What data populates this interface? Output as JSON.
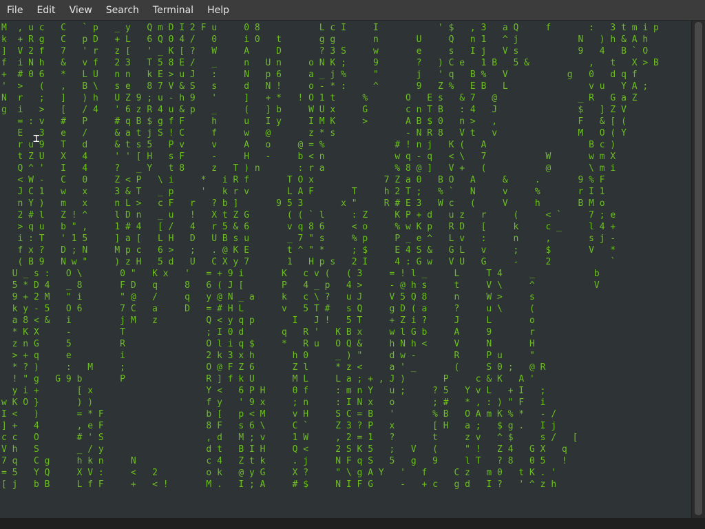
{
  "menubar": {
    "items": [
      {
        "label": "File"
      },
      {
        "label": "Edit"
      },
      {
        "label": "View"
      },
      {
        "label": "Search"
      },
      {
        "label": "Terminal"
      },
      {
        "label": "Help"
      }
    ]
  },
  "terminal": {
    "text_color": "#6cbf1e",
    "highlight_color": "#ffffff",
    "background": "#2e3436",
    "rows": [
      "M  , u c   C   ` p   _ y   Q m D I 2 F u     0 8           L c I     I           ' $   , 3   a Q     f       :   3 t m i p",
      "k  + R g   C   p D   + L   6 Q 0 4 /   0     i 0   t       g g       n       U     Q   n 1   ^ j           N   ) h & A h",
      "]  V 2 f   7   ' r   z [   ' _ K [ ?   W     A     D       ? 3 S     w       e     s   I j   V s           9   4   B ` O",
      "f  i N h   &   v f   2 3   T 5 8 E /   _     n   U n     o N K ;     9       ?   ) C e   1 B   5 &           ,   t   X > B",
      "+  # 0 6   *   L U   n n   k E > u J   :     N   p 6     a _ j %     \"       j   ' q   B %   V           g   0   d q f",
      "'  >   (   ,   B \\   s e   8 7 V & S   s     d   N !     o - * :     ^       9   Z %   E B   L               v u   Y A ;",
      "N  r   ;   ]   ) h   U Z 9 ; u - h 9   '     ]   + *   ! O 1 t     %       O   E s   & 7   @               _ R   G a Z",
      "g  i   >   [   / 4   ' 6 z R 4 u & p   _     (   ] b     W U x     G       c n T B   : 4   J               $   ] Z V",
      "   = : v   #   P     # q B $ g f F     h     u   I y     I M K     >       A B $ 0   n >   ,               F   & [ (",
      "   E   3   e   /     & a t j S ! C     f     w   @       z * s             - N R 8   V t   v               M   O ( Y",
      "   r u 9   T   d     & t s 5   P v     v     A   o     @ = %             # ! n j   K (   A                   B c )",
      "   t Z U   X   4     ' ' [ H   s F     -     H   -     b < n             w q - q   < \\   7           W       w m X",
      "   Q ^ '   I   4     ?   _ Y   t 8     z   T ) n       : r a             % 8 @ ]   V +   (           @       \\ m i",
      "   < W -   C   0     Z < P   \\ i     *   i R f       T O x             7 Z a 0   B O   A     &     .       9 % F",
      "   J C 1   w   x     3 & T   _ p     '   k r v       L A F       T     h 2 T ;   % `   N     v     %       r I 1",
      "   n Y )   m   x     n L >   c F   r   ? b ]       9 5 3       x \"     R # E 3   W c   (     V     h       B M o",
      "   2 # l   Z ! ^     l D n   _ u   !   X t Z G       ( ( ` l     : Z     K P + d   u z   r     (     < `     7 ; e",
      "   > q u   b \" ,     1 # 4   [ /   4   r 5 & 6       v q 8 6     < o     % w K p   R D   [     k     c _     l 4 +",
      "   i : T   ' 1 5     ] a [   L H   D   U B s u       _ 7 \" s     % p     P _ e ^   L v   :     n     ,       s j -",
      "   f x ?   D ; N     M p c   6 >   ;   . @ K E       t ^ \" *     ; $     E 4 S &   G L   v     ;     $       V   *",
      "   ( B 9   N w \"     ) z H   5 d   U   C X y 7       1   H p s   2 I     4 : G w   V U   G     -     2           `",
      "  U _ s :   O \\       0 \"   K x   '   = + 9 i       K   c v (   ( 3     = ! l _     L     T 4     _           b",
      "  5 * D 4   _ 8       F D   q     8   6 ( J [       P   4 _ p   4 >     - @ h s     t     V \\     ^           V",
      "  9 + 2 M   \" i       \" @   /     q   y @ N _ a     k   c \\ ?   u J     V 5 Q 8     n     W >     s",
      "  k y - 5   O 6       7 C   a     D   = # H L       v   5 T #   s Q     g D ( a     ?     u \\     (",
      "  a 8 < &   i         j M   z         Q < y q p       I   J !   5 T     + Z i ?     J     L       o",
      "  * K X     -         T               ; I 0 d       q   R '   K B x     w l G b     A     9       r",
      "  z n G     5         R               O l i q $     *   R u   O Q &     h N h <     V     N       H",
      "  > + q     e         i               2 k 3 x h       h 0     _ ) \"     d w -       R     P u     \"",
      "  * ? )     :   M     ;               O @ F Z 6       Z l     * z <     a ' _       (     S 0 ;   @ R",
      "  ! \" g   G 9 b       P               R ] f k U       M L     L a ; + , J )       P     c & K   A '",
      "  y i +       [ x                     Y <   6 P H     0 f     : m n Y   u ;     ? 5   Y v L   + I   ;",
      "w K O }       ) )                     f y   ' 9 x     ; n     : I N x   o       ; #   * , : ) \" F   i",
      "I <   )       = * F                   b [   p < M     v H     S C = B   '       % B   O A m K % *   - /",
      "] +   4       , e F                   8 F   s 6 \\     C `     Z 3 ? P   x       [ H   a ;   $ g .   I j",
      "c c   O       # ' S                   , d   M ; v     1 W     , 2 = 1   ?       t     z v   ^ $     s /   [",
      "V h   S       _ / y                   d t   B I H     Q <     2 S K 5   ;   V   (     \" !   Z 4   G X   q",
      "7 q   C g     h k n     N             c 4   Z t k     . j     N F q S   5   g   9     l T   ? 8   0 5   !",
      "= 5   Y Q     X V :     <   2         o k   @ y G     X ?     \" \\ g A Y   '   f     C z   m 0   t K . '",
      "[ j   b B     L f F     +   < !       M .   I ; A     # $     N I F G     -   + c   g d   I ?   ' ^ z h"
    ]
  }
}
